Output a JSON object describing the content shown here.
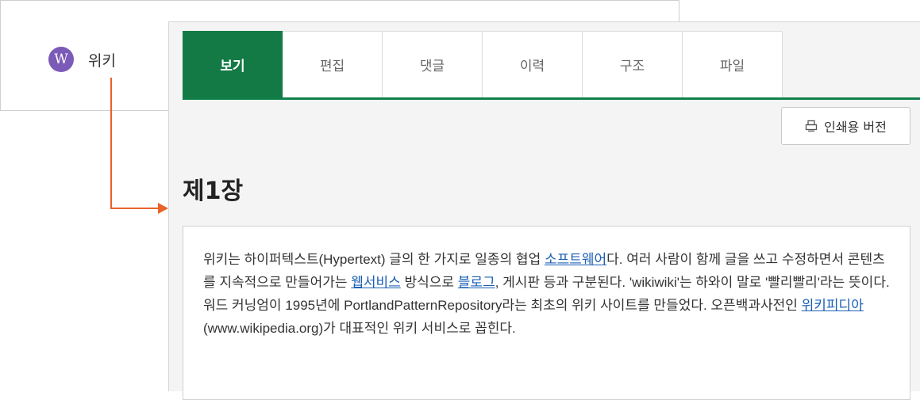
{
  "sidebar": {
    "wiki_logo_letter": "W",
    "wiki_label": "위키"
  },
  "tabs": [
    {
      "label": "보기",
      "active": true
    },
    {
      "label": "편집",
      "active": false
    },
    {
      "label": "댓글",
      "active": false
    },
    {
      "label": "이력",
      "active": false
    },
    {
      "label": "구조",
      "active": false
    },
    {
      "label": "파일",
      "active": false
    }
  ],
  "toolbar": {
    "print_label": "인쇄용 버전",
    "print_icon": "printer-icon"
  },
  "page": {
    "title": "제1장",
    "body": {
      "t1": "위키는 하이퍼텍스트(Hypertext) 글의 한 가지로 일종의 협업 ",
      "link1": "소프트웨어",
      "t2": "다. 여러 사람이 함께 글을 쓰고 수정하면서 콘텐츠를 지속적으로 만들어가는 ",
      "link2": "웹서비스",
      "t3": " 방식으로 ",
      "link3": "블로그",
      "t4": ", 게시판 등과 구분된다. 'wikiwiki'는 하와이 말로 '빨리빨리'라는 뜻이다. 워드 커닝엄이 1995년에 PortlandPatternRepository라는 최초의 위키 사이트를 만들었다. 오픈백과사전인 ",
      "link4": "위키피디아",
      "t5": "(www.wikipedia.org)가 대표적인 위키 서비스로 꼽힌다."
    }
  },
  "colors": {
    "accent": "#137a45",
    "logo": "#7b5ab8",
    "arrow": "#e8622a",
    "link": "#1a5fb4"
  }
}
